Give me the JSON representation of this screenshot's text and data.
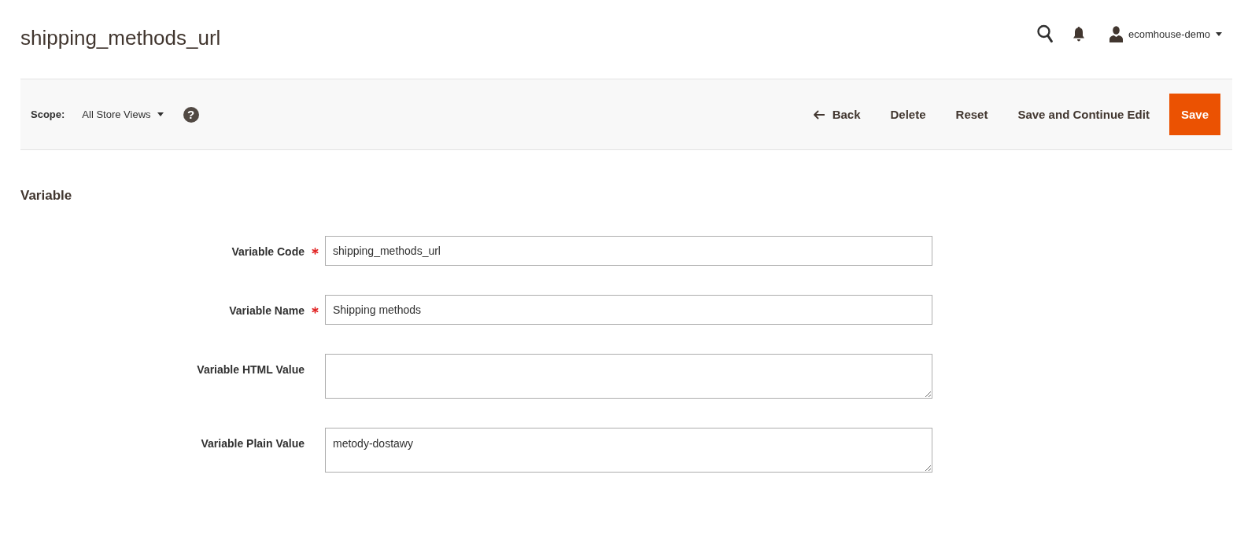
{
  "page": {
    "title": "shipping_methods_url"
  },
  "header": {
    "user": {
      "name": "ecomhouse-demo"
    }
  },
  "toolbar": {
    "scope": {
      "label": "Scope:",
      "value": "All Store Views",
      "help": "?"
    },
    "buttons": [
      {
        "label": "Back",
        "kind": "back"
      },
      {
        "label": "Delete",
        "kind": "text"
      },
      {
        "label": "Reset",
        "kind": "text"
      },
      {
        "label": "Save and Continue Edit",
        "kind": "text"
      },
      {
        "label": "Save",
        "kind": "primary"
      }
    ]
  },
  "section": {
    "title": "Variable",
    "fields": [
      {
        "label": "Variable Code",
        "required": true,
        "kind": "input",
        "value": "shipping_methods_url"
      },
      {
        "label": "Variable Name",
        "required": true,
        "kind": "input",
        "value": "Shipping methods"
      },
      {
        "label": "Variable HTML Value",
        "required": false,
        "kind": "textarea"
      },
      {
        "label": "Variable Plain Value",
        "required": false,
        "kind": "textarea",
        "value": "metody-dostawy"
      }
    ]
  }
}
